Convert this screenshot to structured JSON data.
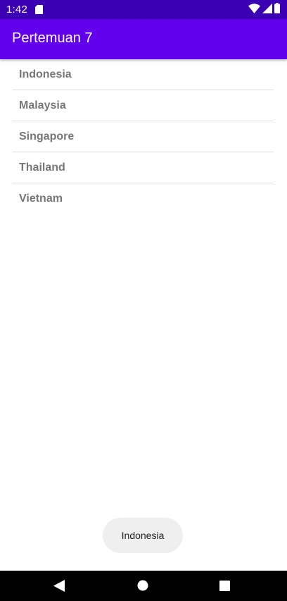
{
  "status_bar": {
    "time": "1:42",
    "icons": [
      "sd-card-icon",
      "wifi-icon",
      "signal-icon",
      "battery-icon"
    ]
  },
  "app_bar": {
    "title": "Pertemuan 7"
  },
  "list": {
    "items": [
      {
        "label": "Indonesia"
      },
      {
        "label": "Malaysia"
      },
      {
        "label": "Singapore"
      },
      {
        "label": "Thailand"
      },
      {
        "label": "Vietnam"
      }
    ]
  },
  "toast": {
    "text": "Indonesia"
  },
  "nav_bar": {
    "buttons": [
      "back-icon",
      "home-icon",
      "recents-icon"
    ]
  },
  "colors": {
    "status_bar": "#3b00b3",
    "app_bar": "#6200ee",
    "list_text": "#777777",
    "divider": "#dedede",
    "toast_bg": "#efefef"
  }
}
